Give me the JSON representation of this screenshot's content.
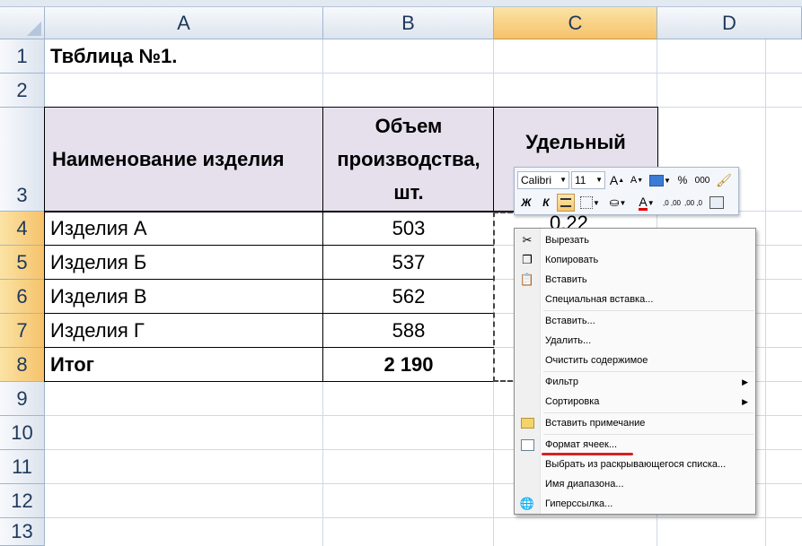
{
  "columns": [
    "A",
    "B",
    "C",
    "D"
  ],
  "rows": [
    "1",
    "2",
    "3",
    "4",
    "5",
    "6",
    "7",
    "8",
    "9",
    "10",
    "11",
    "12",
    "13"
  ],
  "cells": {
    "a1": "Твблица №1.",
    "a3": "Наименование изделия",
    "b3_line1": "Объем",
    "b3_line2": "производства,",
    "b3_line3": "шт.",
    "c3": "Удельный",
    "c4_partial": "0,22",
    "table_rows": [
      {
        "name": "Изделия А",
        "value": "503"
      },
      {
        "name": "Изделия Б",
        "value": "537"
      },
      {
        "name": "Изделия В",
        "value": "562"
      },
      {
        "name": "Изделия Г",
        "value": "588"
      }
    ],
    "total_label": "Итог",
    "total_value": "2 190"
  },
  "mini_toolbar": {
    "font_name": "Calibri",
    "font_size": "11",
    "grow_font": "A",
    "shrink_font": "A",
    "percent": "%",
    "thousands": "000",
    "bold": "Ж",
    "italic": "К",
    "font_color": "A",
    "dec_inc": ",0 ,00",
    "dec_dec": ",00 ,0"
  },
  "context_menu": {
    "items": [
      {
        "label": "Вырезать",
        "icon": "scissors-icon"
      },
      {
        "label": "Копировать",
        "icon": "copy-icon"
      },
      {
        "label": "Вставить",
        "icon": "paste-icon"
      },
      {
        "label": "Специальная вставка...",
        "icon": ""
      },
      {
        "label": "Вставить...",
        "icon": ""
      },
      {
        "label": "Удалить...",
        "icon": ""
      },
      {
        "label": "Очистить содержимое",
        "icon": ""
      },
      {
        "label": "Фильтр",
        "icon": "",
        "submenu": true
      },
      {
        "label": "Сортировка",
        "icon": "",
        "submenu": true
      },
      {
        "label": "Вставить примечание",
        "icon": "comment-icon"
      },
      {
        "label": "Формат ячеек...",
        "icon": "format-cells-icon"
      },
      {
        "label": "Выбрать из раскрывающегося списка...",
        "icon": ""
      },
      {
        "label": "Имя диапазона...",
        "icon": ""
      },
      {
        "label": "Гиперссылка...",
        "icon": "hyperlink-icon"
      }
    ]
  },
  "colors": {
    "header_fill": "#e5e0ec",
    "selected_header": "#f6c26a",
    "underline": "#d92020"
  }
}
